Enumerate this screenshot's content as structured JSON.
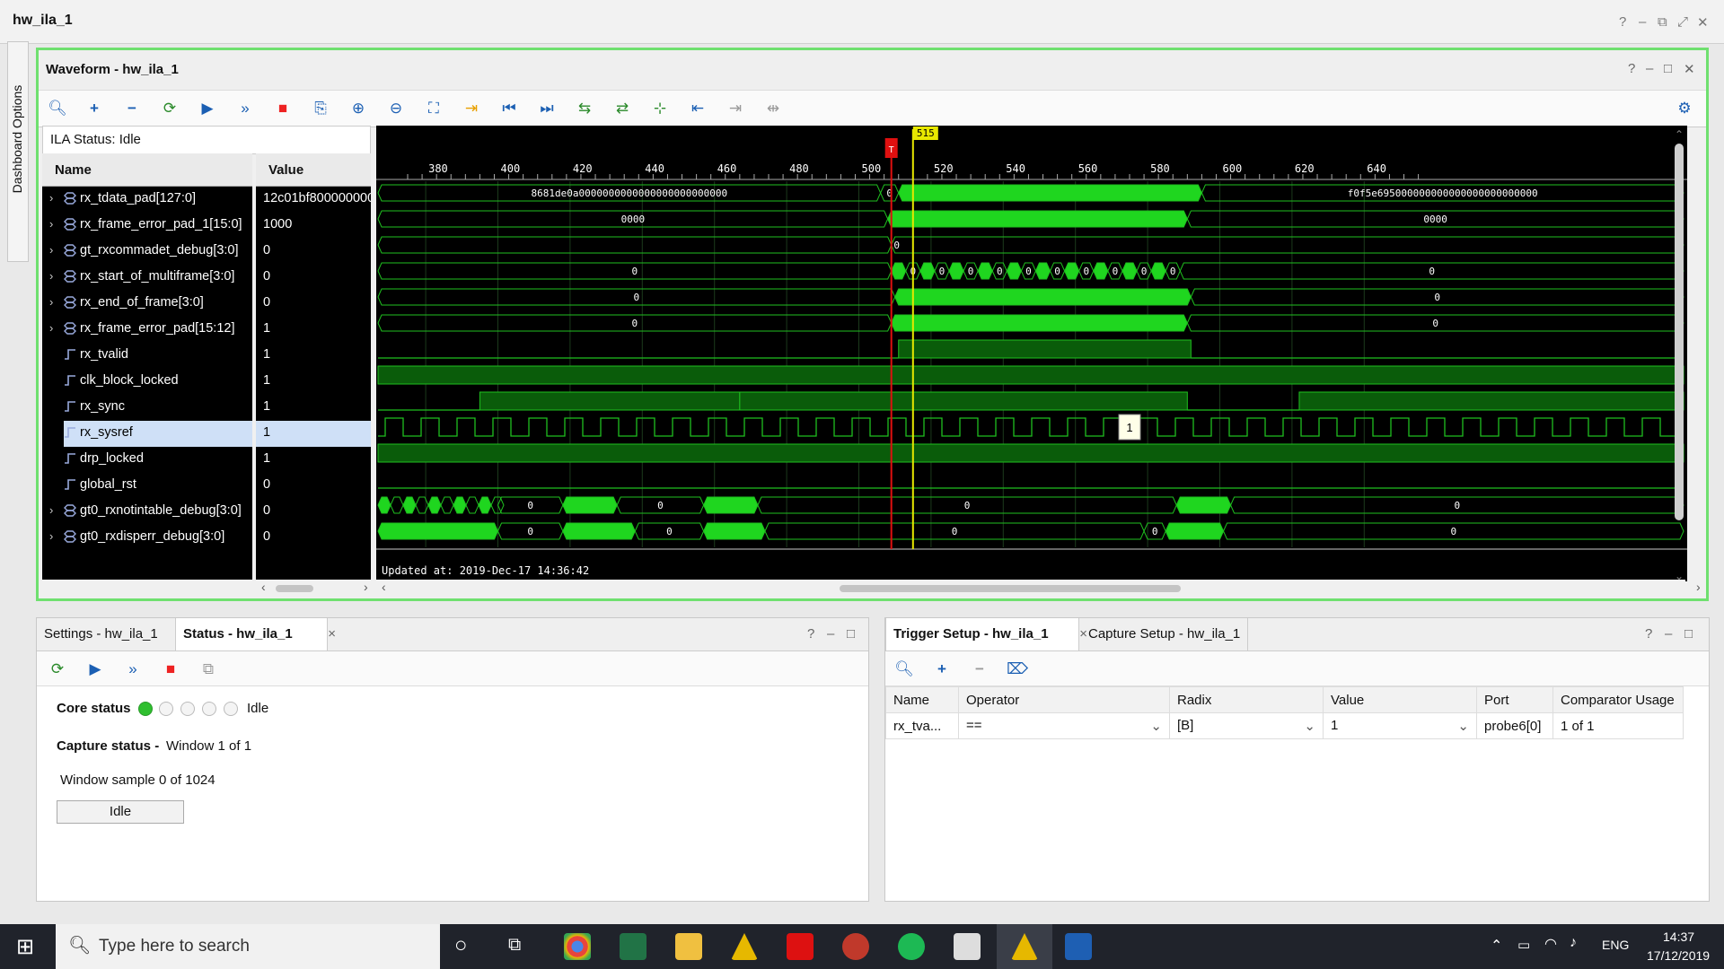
{
  "app": {
    "title": "hw_ila_1",
    "controls": [
      "?",
      "–",
      "⧉",
      "⤢",
      "✕"
    ]
  },
  "side_tab": {
    "label": "Dashboard Options"
  },
  "waveform": {
    "title": "Waveform - hw_ila_1",
    "header_controls": [
      "?",
      "–",
      "□",
      "✕"
    ],
    "ila_status": "ILA Status: Idle",
    "name_header": "Name",
    "value_header": "Value",
    "signals": [
      {
        "name": "rx_tdata_pad[127:0]",
        "value": "12c01bf800000000",
        "bus": true
      },
      {
        "name": "rx_frame_error_pad_1[15:0]",
        "value": "1000",
        "bus": true
      },
      {
        "name": "gt_rxcommadet_debug[3:0]",
        "value": "0",
        "bus": true
      },
      {
        "name": "rx_start_of_multiframe[3:0]",
        "value": "0",
        "bus": true
      },
      {
        "name": "rx_end_of_frame[3:0]",
        "value": "0",
        "bus": true
      },
      {
        "name": "rx_frame_error_pad[15:12]",
        "value": "1",
        "bus": true
      },
      {
        "name": "rx_tvalid",
        "value": "1",
        "bus": false
      },
      {
        "name": "clk_block_locked",
        "value": "1",
        "bus": false
      },
      {
        "name": "rx_sync",
        "value": "1",
        "bus": false
      },
      {
        "name": "rx_sysref",
        "value": "1",
        "bus": false,
        "selected": true
      },
      {
        "name": "drp_locked",
        "value": "1",
        "bus": false
      },
      {
        "name": "global_rst",
        "value": "0",
        "bus": false
      },
      {
        "name": "gt0_rxnotintable_debug[3:0]",
        "value": "0",
        "bus": true
      },
      {
        "name": "gt0_rxdisperr_debug[3:0]",
        "value": "0",
        "bus": true
      }
    ],
    "ruler_ticks": [
      "380",
      "400",
      "420",
      "440",
      "460",
      "480",
      "500",
      "520",
      "540",
      "560",
      "580",
      "600",
      "620",
      "640"
    ],
    "cursor_label": "515",
    "trigger_marker": "T",
    "wave_labels": {
      "tdata_left": "8681de0a0000000000000000000000000",
      "tdata_right": "f0f5e695000000000000000000000000",
      "tdata_glitch": "0",
      "frame_err": "0000",
      "zero": "0",
      "sysref_tooltip": "1"
    },
    "updated_text": "Updated at: 2019-Dec-17 14:36:42"
  },
  "status_panel": {
    "tabs": [
      "Settings - hw_ila_1",
      "Status - hw_ila_1"
    ],
    "close": "×",
    "controls": [
      "?",
      "–",
      "□"
    ],
    "core_status_label": "Core status",
    "core_status_value": "Idle",
    "capture_status_label": "Capture status -",
    "capture_status_value": "Window 1 of 1",
    "window_sample": "Window sample 0 of 1024",
    "progress_label": "Idle"
  },
  "trigger_panel": {
    "tabs": [
      "Trigger Setup - hw_ila_1",
      "Capture Setup - hw_ila_1"
    ],
    "close": "×",
    "controls": [
      "?",
      "–",
      "□"
    ],
    "columns": [
      "Name",
      "Operator",
      "Radix",
      "Value",
      "Port",
      "Comparator Usage"
    ],
    "row": {
      "name": "rx_tva...",
      "operator": "==",
      "radix": "[B]",
      "value": "1",
      "port": "probe6[0]",
      "usage": "1 of 1"
    }
  },
  "taskbar": {
    "search_placeholder": "Type here to search",
    "lang": "ENG",
    "time": "14:37",
    "date": "17/12/2019"
  },
  "colors": {
    "accent_green": "#6fe06f",
    "wave_green": "#1fd61f",
    "wave_dark": "#0a5c0a",
    "cursor": "#e8e800",
    "trigger_red": "#e01010"
  }
}
